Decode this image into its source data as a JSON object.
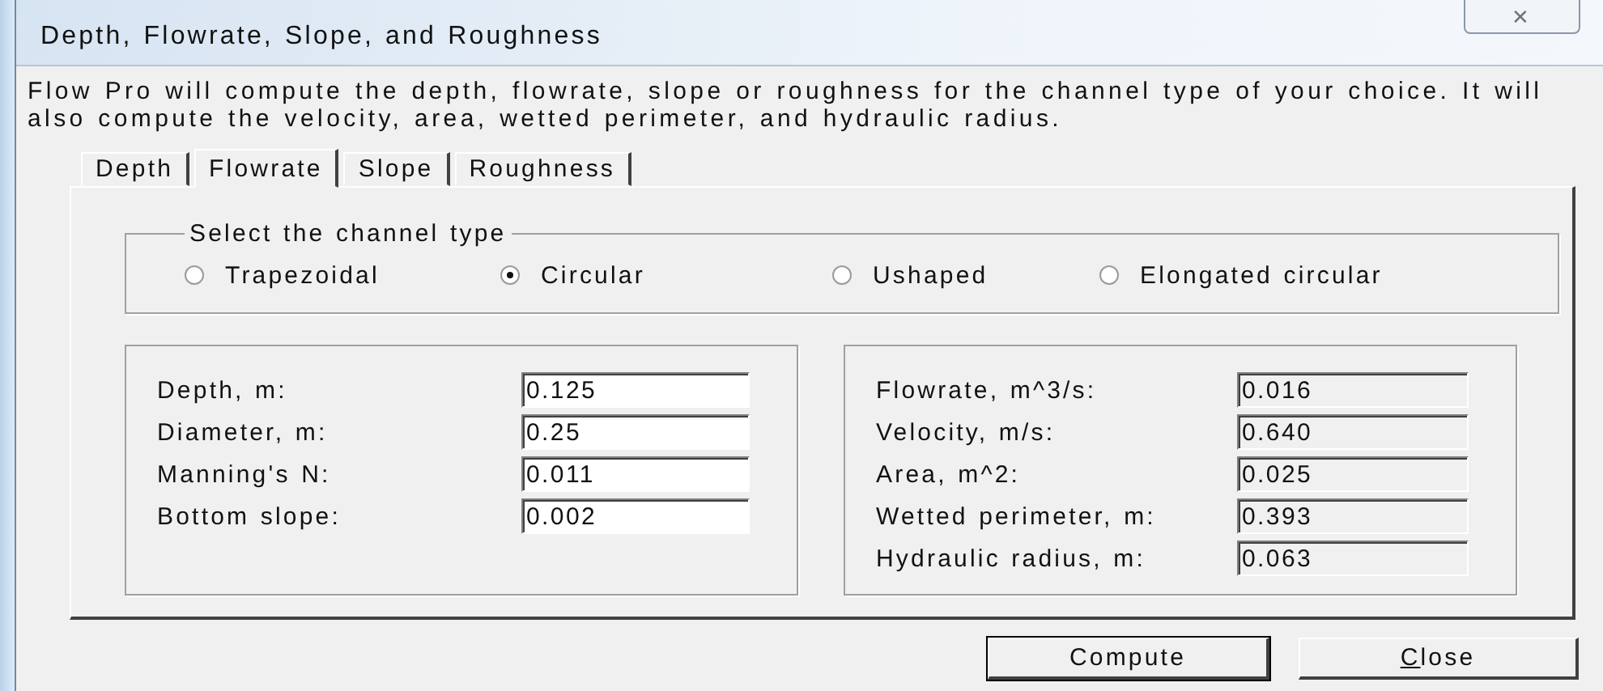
{
  "window": {
    "title": "Depth, Flowrate, Slope, and Roughness",
    "close_icon": "✕"
  },
  "description": "Flow Pro will compute the depth, flowrate, slope or roughness for the channel type of your choice.  It will also compute the velocity, area, wetted perimeter, and hydraulic radius.",
  "tabs": [
    {
      "label": "Depth",
      "selected": false
    },
    {
      "label": "Flowrate",
      "selected": true
    },
    {
      "label": "Slope",
      "selected": false
    },
    {
      "label": "Roughness",
      "selected": false
    }
  ],
  "channel_type": {
    "label": "Select the channel type",
    "options": [
      {
        "label": "Trapezoidal",
        "selected": false
      },
      {
        "label": "Circular",
        "selected": true
      },
      {
        "label": "Ushaped",
        "selected": false
      },
      {
        "label": "Elongated circular",
        "selected": false
      }
    ]
  },
  "inputs": [
    {
      "label": "Depth, m:",
      "value": "0.125"
    },
    {
      "label": "Diameter, m:",
      "value": "0.25"
    },
    {
      "label": "Manning's N:",
      "value": "0.011"
    },
    {
      "label": "Bottom slope:",
      "value": "0.002"
    }
  ],
  "results": [
    {
      "label": "Flowrate, m^3/s:",
      "value": "0.016"
    },
    {
      "label": "Velocity, m/s:",
      "value": "0.640"
    },
    {
      "label": "Area, m^2:",
      "value": "0.025"
    },
    {
      "label": "Wetted perimeter, m:",
      "value": "0.393"
    },
    {
      "label": "Hydraulic radius, m:",
      "value": "0.063"
    }
  ],
  "buttons": [
    {
      "label": "Compute",
      "kind": "default"
    },
    {
      "label": "Close",
      "kind": "mnemonic"
    }
  ]
}
